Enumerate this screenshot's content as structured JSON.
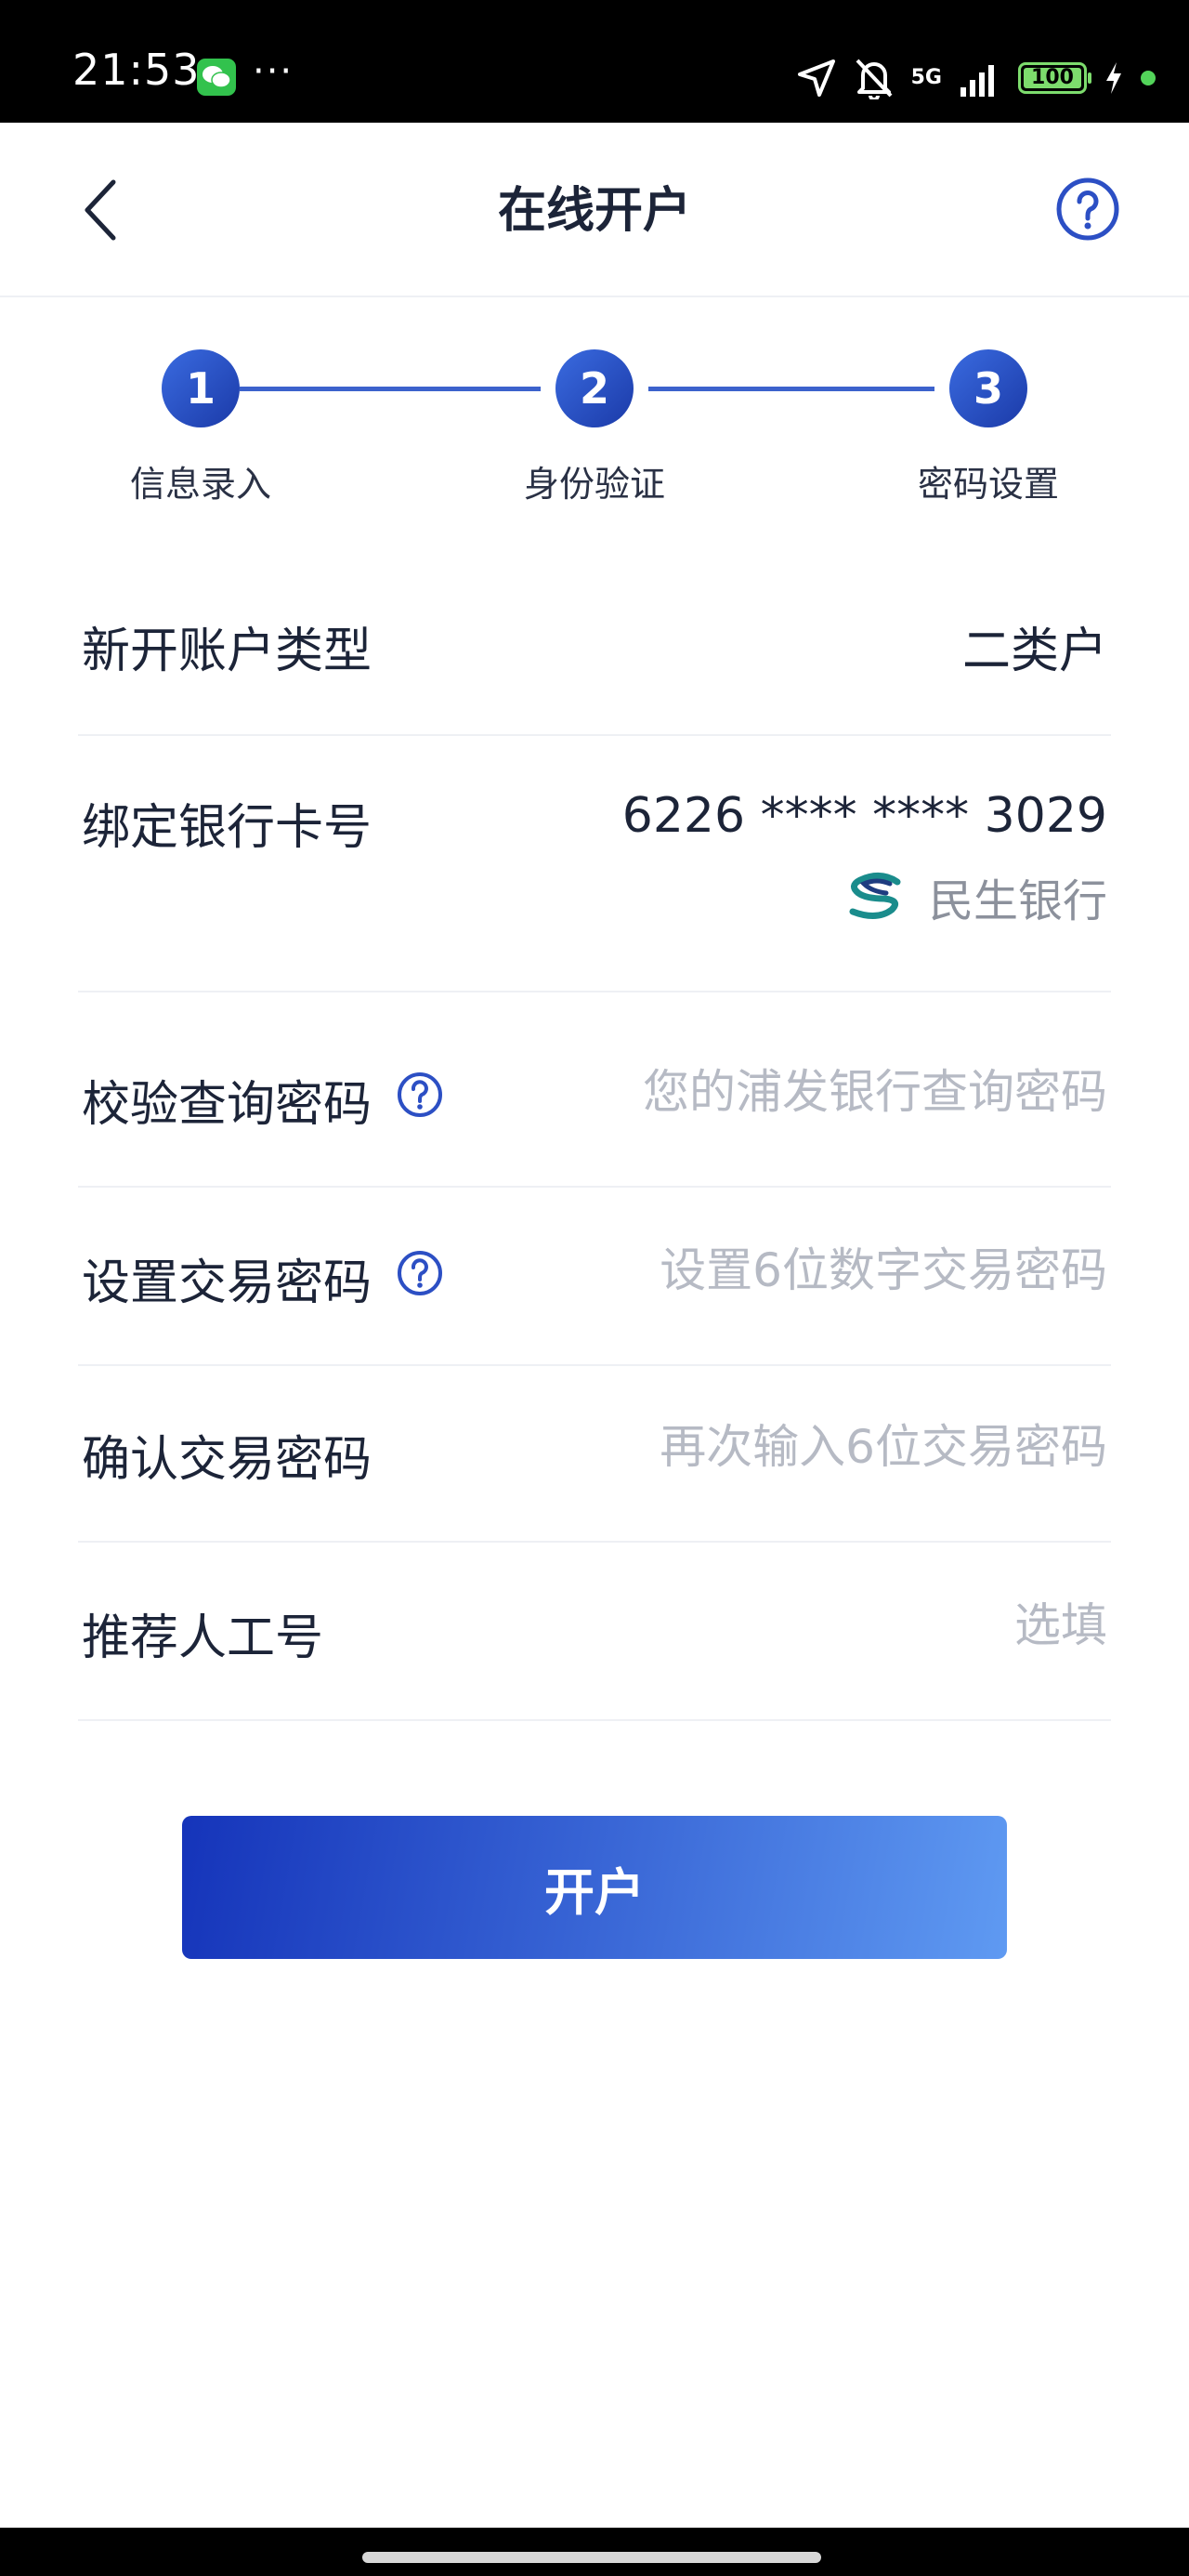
{
  "status_bar": {
    "time": "21:53",
    "more": "···",
    "network": "5G",
    "battery": "100",
    "icons": [
      "wechat-icon",
      "location-arrow-icon",
      "bell-off-icon",
      "signal-icon",
      "battery-icon",
      "charging-icon"
    ]
  },
  "header": {
    "title": "在线开户",
    "back_icon": "chevron-left-icon",
    "help_icon": "question-circle-icon"
  },
  "stepper": {
    "steps": [
      {
        "number": "1",
        "label": "信息录入"
      },
      {
        "number": "2",
        "label": "身份验证"
      },
      {
        "number": "3",
        "label": "密码设置"
      }
    ]
  },
  "form": {
    "account_type": {
      "label": "新开账户类型",
      "value": "二类户"
    },
    "bank_card": {
      "label": "绑定银行卡号",
      "value": "6226 **** **** 3029",
      "bank_name": "民生银行"
    },
    "query_password": {
      "label": "校验查询密码",
      "value": "",
      "placeholder": "您的浦发银行查询密码"
    },
    "trade_password": {
      "label": "设置交易密码",
      "value": "",
      "placeholder": "设置6位数字交易密码"
    },
    "confirm_password": {
      "label": "确认交易密码",
      "value": "",
      "placeholder": "再次输入6位交易密码"
    },
    "referrer": {
      "label": "推荐人工号",
      "value": "",
      "placeholder": "选填"
    }
  },
  "submit": {
    "label": "开户"
  },
  "colors": {
    "accent": "#2c4fc4",
    "accent_light": "#5f9af2",
    "placeholder": "#b6bac4",
    "divider": "#eef0f4"
  }
}
